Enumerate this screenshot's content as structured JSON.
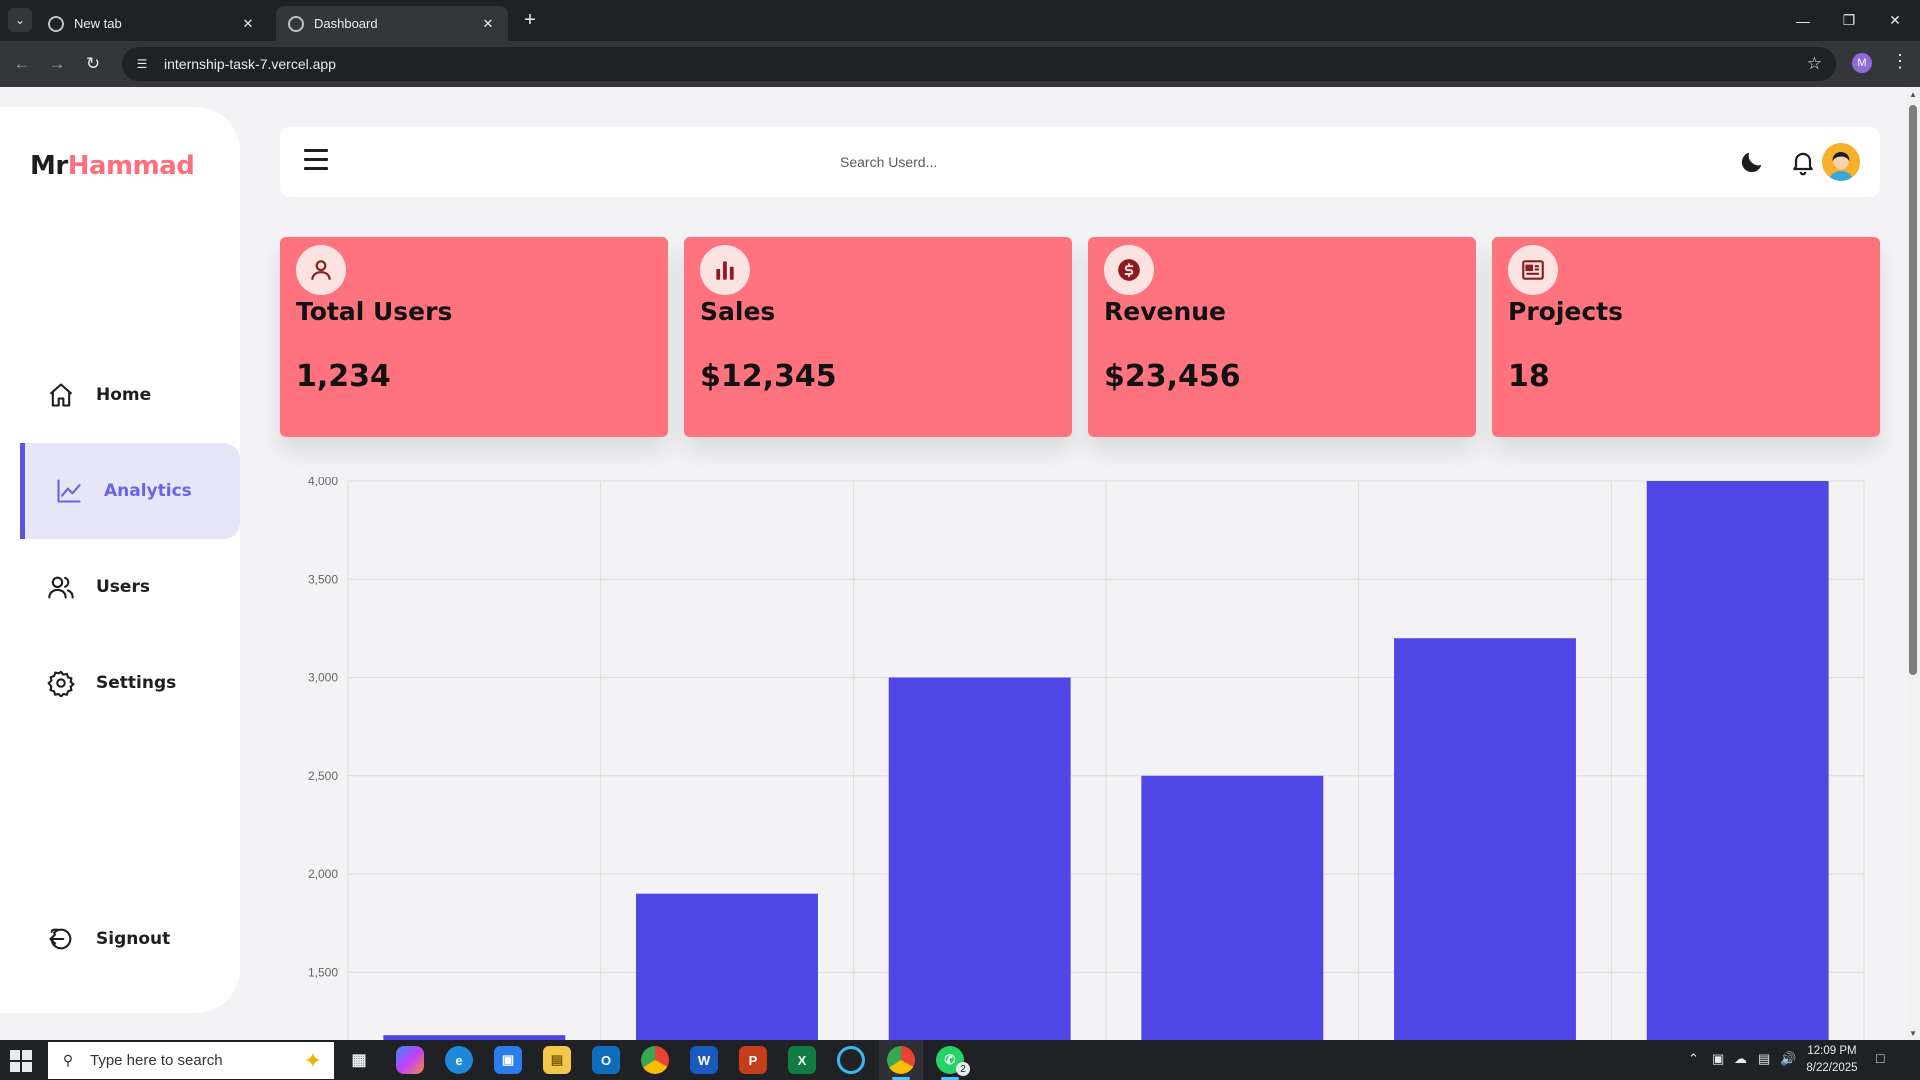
{
  "browser": {
    "tabs": [
      {
        "title": "New tab",
        "active": false
      },
      {
        "title": "Dashboard",
        "active": true
      }
    ],
    "url": "internship-task-7.vercel.app",
    "profile_initial": "M"
  },
  "brand": {
    "part1": "Mr",
    "part2": "Hammad"
  },
  "sidebar": {
    "items": [
      {
        "label": "Home",
        "icon": "home-icon",
        "active": false
      },
      {
        "label": "Analytics",
        "icon": "analytics-icon",
        "active": true
      },
      {
        "label": "Users",
        "icon": "users-icon",
        "active": false
      },
      {
        "label": "Settings",
        "icon": "settings-icon",
        "active": false
      }
    ],
    "signout": {
      "label": "Signout",
      "icon": "signout-icon"
    }
  },
  "header": {
    "search_placeholder": "Search Userd..."
  },
  "cards": [
    {
      "title": "Total Users",
      "value": "1,234",
      "icon": "user-icon"
    },
    {
      "title": "Sales",
      "value": "$12,345",
      "icon": "bar-chart-icon"
    },
    {
      "title": "Revenue",
      "value": "$23,456",
      "icon": "dollar-icon"
    },
    {
      "title": "Projects",
      "value": "18",
      "icon": "newspaper-icon"
    }
  ],
  "colors": {
    "accent": "#5b53e3",
    "card_bg": "#ff737e",
    "brand_pink": "#ff6f7b",
    "bar_color": "#5046e5"
  },
  "chart_data": {
    "type": "bar",
    "categories": [
      "",
      "",
      "",
      "",
      "",
      ""
    ],
    "values": [
      1180,
      1900,
      3000,
      2500,
      3200,
      4000
    ],
    "yticks": [
      "1,500",
      "2,000",
      "2,500",
      "3,000",
      "3,500",
      "4,000"
    ],
    "ylim": [
      1120,
      4000
    ],
    "grid": true,
    "title": "",
    "xlabel": "",
    "ylabel": ""
  },
  "taskbar": {
    "search_placeholder": "Type here to search",
    "time": "12:09 PM",
    "date": "8/22/2025",
    "whatsapp_badge": "2"
  }
}
